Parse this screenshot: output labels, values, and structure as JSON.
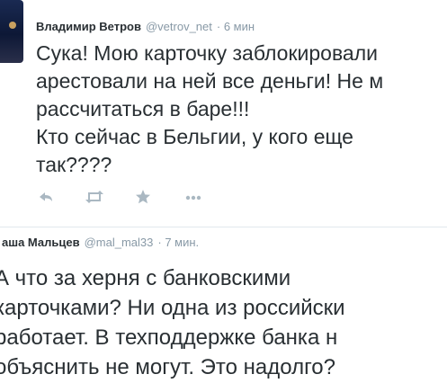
{
  "tweets": [
    {
      "author": "Владимир Ветров",
      "handle": "@vetrov_net",
      "time": "· 6 мин",
      "text": "Сука! Мою карточку заблокировали\nарестовали на ней все деньги! Не м\nрассчитаться в баре!!!\nКто сейчас в Бельгии, у кого еще\nтак????",
      "actions": [
        "reply-icon",
        "retweet-icon",
        "star-icon",
        "more-icon"
      ]
    },
    {
      "author": "аша Мальцев",
      "handle": "@mal_mal33",
      "time": "· 7 мин.",
      "text": "А что за херня с банковскими\nкарточками? Ни одна из российски\nработает. В техподдержке банка н\nобъяснить не могут. Это надолго?"
    }
  ],
  "colors": {
    "text": "#292f33",
    "meta": "#8899a6",
    "icon": "#aab8c2",
    "divider": "#e1e8ed"
  }
}
